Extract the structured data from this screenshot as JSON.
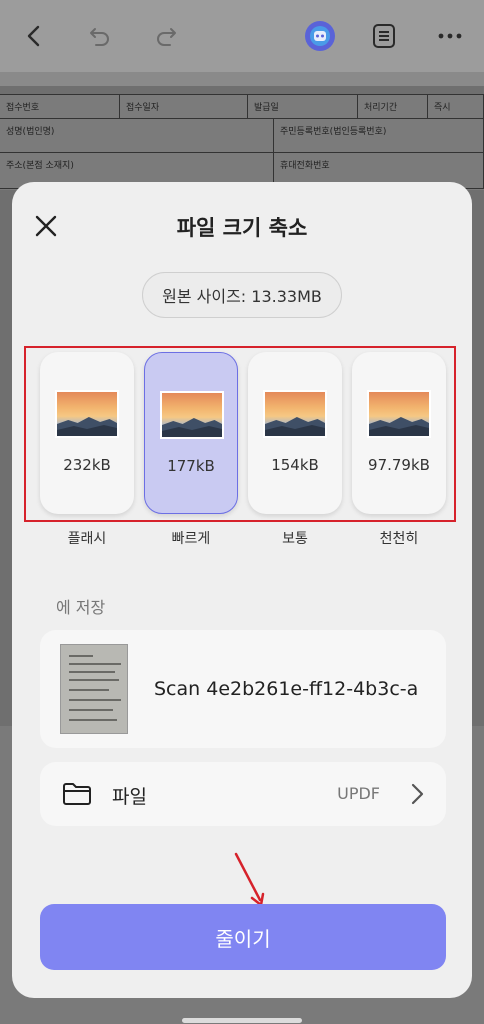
{
  "toolbar": {
    "icons": [
      "back-icon",
      "undo-icon",
      "redo-icon",
      "ai-assistant-icon",
      "list-icon",
      "more-icon"
    ]
  },
  "background_document": {
    "row1": [
      "접수번호",
      "접수일자",
      "발급일",
      "처리기간",
      "즉시"
    ],
    "row2": [
      "성명(법인명)",
      "주민등록번호(법인등록번호)"
    ],
    "row3": [
      "주소(본점 소재지)",
      "휴대전화번호"
    ]
  },
  "dialog": {
    "title": "파일 크기 축소",
    "original_size": "원본 사이즈: 13.33MB",
    "options": [
      {
        "size": "232kB",
        "label": "플래시",
        "selected": false
      },
      {
        "size": "177kB",
        "label": "빠르게",
        "selected": true
      },
      {
        "size": "154kB",
        "label": "보통",
        "selected": false
      },
      {
        "size": "97.79kB",
        "label": "천천히",
        "selected": false
      }
    ],
    "save_heading": "에 저장",
    "file_name": "Scan 4e2b261e-ff12-4b3c-a",
    "destination": {
      "label": "파일",
      "value": "UPDF"
    },
    "reduce_button": "줄이기"
  },
  "colors": {
    "accent": "#8085f2",
    "selected_option_bg": "#c9caf2",
    "annotation_red": "#d6222b"
  }
}
